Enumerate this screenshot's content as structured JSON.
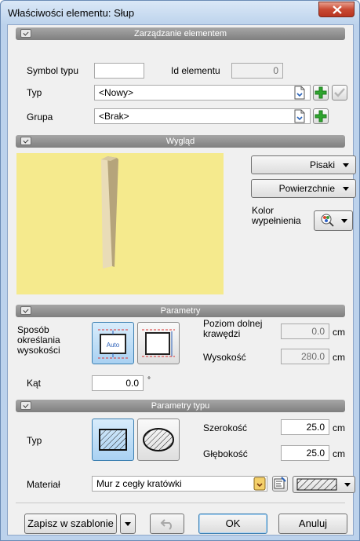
{
  "window": {
    "title": "Właściwości elementu: Słup"
  },
  "sections": {
    "management": "Zarządzanie elementem",
    "appearance": "Wygląd",
    "parameters": "Parametry",
    "type_parameters": "Parametry typu"
  },
  "management": {
    "type_symbol_label": "Symbol typu",
    "type_symbol_value": "",
    "element_id_label": "Id elementu",
    "element_id_value": "0",
    "type_label": "Typ",
    "type_value": "<Nowy>",
    "group_label": "Grupa",
    "group_value": "<Brak>"
  },
  "appearance": {
    "pens_button": "Pisaki",
    "surfaces_button": "Powierzchnie",
    "fill_color_label_line1": "Kolor",
    "fill_color_label_line2": "wypełnienia"
  },
  "parameters": {
    "height_method_line1": "Sposób",
    "height_method_line2": "określania",
    "height_method_line3": "wysokości",
    "auto_label": "Auto",
    "bottom_level_line1": "Poziom dolnej",
    "bottom_level_line2": "krawędzi",
    "bottom_level_value": "0.0",
    "bottom_level_unit": "cm",
    "height_label": "Wysokość",
    "height_value": "280.0",
    "height_unit": "cm",
    "angle_label": "Kąt",
    "angle_value": "0.0",
    "angle_unit": "°"
  },
  "type_parameters": {
    "type_label": "Typ",
    "width_label": "Szerokość",
    "width_value": "25.0",
    "width_unit": "cm",
    "depth_label": "Głębokość",
    "depth_value": "25.0",
    "depth_unit": "cm",
    "material_label": "Materiał",
    "material_value": "Mur z cegły kratówki"
  },
  "footer": {
    "save_template": "Zapisz w szablonie",
    "ok": "OK",
    "cancel": "Anuluj"
  },
  "colors": {
    "section_header": "#8c8c8c",
    "preview_bg": "#f5ea8d",
    "plus_green": "#2fa52f",
    "selected_button": "#a9d1f2"
  }
}
